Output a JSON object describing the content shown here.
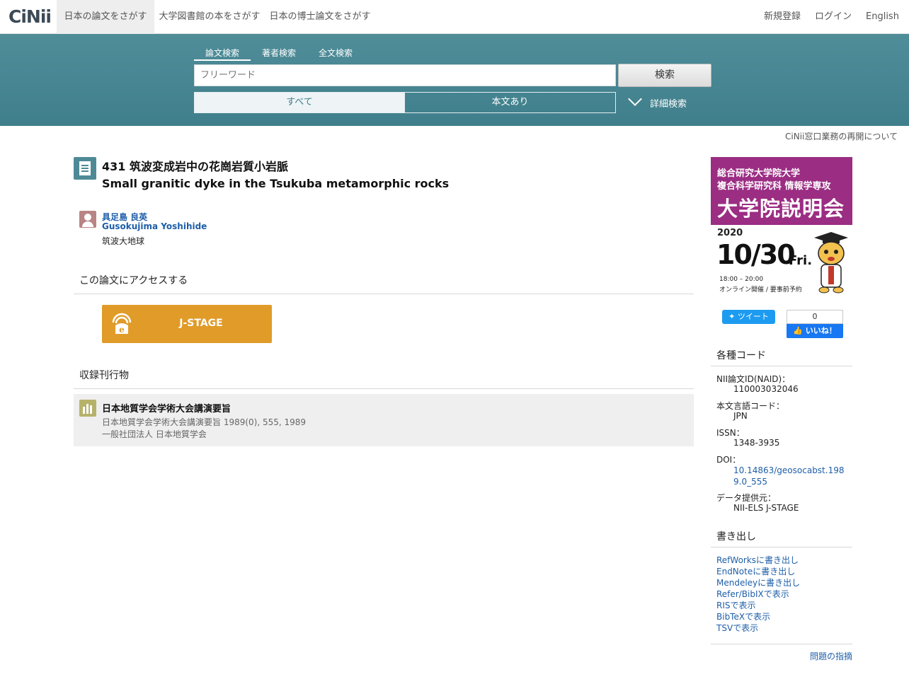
{
  "brand": {
    "logo": "CiNii"
  },
  "topnav": {
    "tabs": [
      "日本の論文をさがす",
      "大学図書館の本をさがす",
      "日本の博士論文をさがす"
    ],
    "right": [
      "新規登録",
      "ログイン",
      "English"
    ]
  },
  "search": {
    "tabs": [
      "論文検索",
      "著者検索",
      "全文検索"
    ],
    "placeholder": "フリーワード",
    "button": "検索",
    "scope_all": "すべて",
    "scope_body": "本文あり",
    "advanced": "詳細検索"
  },
  "notice": "CiNii窓口業務の再開について",
  "article": {
    "title_ja": "431 筑波変成岩中の花崗岩質小岩脈",
    "title_en": "Small granitic dyke in the Tsukuba metamorphic rocks",
    "author_ja": "具足島 良英",
    "author_en": "Gusokujima Yoshihide",
    "affiliation": "筑波大地球"
  },
  "access": {
    "heading": "この論文にアクセスする",
    "jstage": "J-STAGE"
  },
  "journal": {
    "heading": "収録刊行物",
    "title": "日本地質学会学術大会講演要旨",
    "citation": "日本地質学会学術大会講演要旨 1989(0), 555, 1989",
    "publisher": "一般社団法人 日本地質学会"
  },
  "ad": {
    "line1": "総合研究大学院大学",
    "line2": "複合科学研究科 情報学専攻",
    "line3": "大学院説明会",
    "year": "2020",
    "date": "10/30",
    "day": "Fri.",
    "time": "18:00 – 20:00",
    "note": "オンライン開催 / 要事前予約"
  },
  "social": {
    "tweet": "ツイート",
    "like_count": "0",
    "like": "いいね！"
  },
  "codes": {
    "heading": "各種コード",
    "naid_label": "NII論文ID(NAID)：",
    "naid": "110003032046",
    "lang_label": "本文言語コード：",
    "lang": "JPN",
    "issn_label": "ISSN：",
    "issn": "1348-3935",
    "doi_label": "DOI：",
    "doi": "10.14863/geosocabst.1989.0_555",
    "source_label": "データ提供元：",
    "source": "NII-ELS  J-STAGE"
  },
  "export": {
    "heading": "書き出し",
    "items": [
      "RefWorksに書き出し",
      "EndNoteに書き出し",
      "Mendeleyに書き出し",
      "Refer/BibIXで表示",
      "RISで表示",
      "BibTeXで表示",
      "TSVで表示"
    ]
  },
  "report": "問題の指摘"
}
